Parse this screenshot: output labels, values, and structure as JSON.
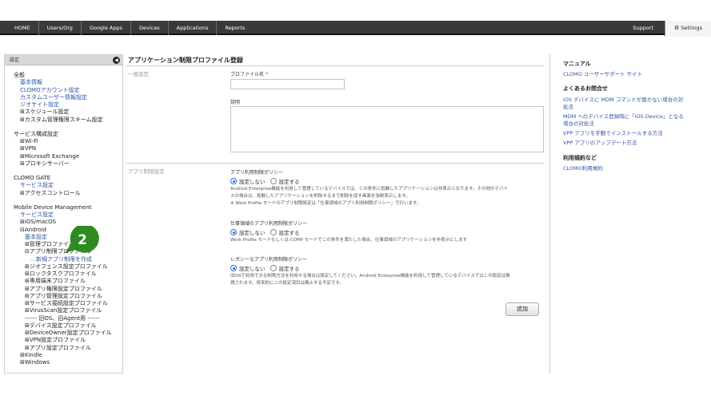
{
  "nav": {
    "items": [
      "HOME",
      "Users/Org",
      "Google Apps",
      "Devices",
      "Applications",
      "Reports"
    ],
    "support": "Support",
    "settings": "Settings"
  },
  "sidebar": {
    "title": "設定",
    "items": [
      {
        "text": "全般",
        "kind": "h",
        "indent": 0
      },
      {
        "text": "基本情報",
        "kind": "l",
        "indent": 1
      },
      {
        "text": "CLOMOアカウント設定",
        "kind": "l",
        "indent": 1
      },
      {
        "text": "カスタムユーザー情報設定",
        "kind": "l",
        "indent": 1
      },
      {
        "text": "ジオサイト設定",
        "kind": "l",
        "indent": 1
      },
      {
        "text": "⊞スケジュール設定",
        "kind": "d",
        "indent": 1
      },
      {
        "text": "⊞カスタム管理権限スキーム設定",
        "kind": "d",
        "indent": 1
      },
      {
        "text": "サービス構成設定",
        "kind": "h",
        "indent": 0
      },
      {
        "text": "⊞Wi-Fi",
        "kind": "d",
        "indent": 1
      },
      {
        "text": "⊞VPN",
        "kind": "d",
        "indent": 1
      },
      {
        "text": "⊞Microsoft Exchange",
        "kind": "d",
        "indent": 1
      },
      {
        "text": "⊞プロキシサーバー",
        "kind": "d",
        "indent": 1
      },
      {
        "text": "CLOMO GATE",
        "kind": "h",
        "indent": 0
      },
      {
        "text": "サービス設定",
        "kind": "l",
        "indent": 1
      },
      {
        "text": "⊞アクセスコントロール",
        "kind": "d",
        "indent": 1
      },
      {
        "text": "Mobile Device Management",
        "kind": "h",
        "indent": 0
      },
      {
        "text": "サービス設定",
        "kind": "l",
        "indent": 1
      },
      {
        "text": "⊞iOS/macOS",
        "kind": "d",
        "indent": 1
      },
      {
        "text": "⊟Android",
        "kind": "d",
        "indent": 1
      },
      {
        "text": "基本設定",
        "kind": "l",
        "indent": 2
      },
      {
        "text": "⊞管理プロファイル",
        "kind": "d",
        "indent": 2
      },
      {
        "text": "⊟アプリ制限プロファイル",
        "kind": "d",
        "indent": 2
      },
      {
        "text": "…新規アプリ制限を作成",
        "kind": "l",
        "indent": 3
      },
      {
        "text": "⊞ジオフェンス設定プロファイル",
        "kind": "d",
        "indent": 2
      },
      {
        "text": "⊞ロックタスクプロファイル",
        "kind": "d",
        "indent": 2
      },
      {
        "text": "⊞専用端末プロファイル",
        "kind": "d",
        "indent": 2
      },
      {
        "text": "⊞アプリ権限設定プロファイル",
        "kind": "d",
        "indent": 2
      },
      {
        "text": "⊞アプリ管理設定プロファイル",
        "kind": "d",
        "indent": 2
      },
      {
        "text": "⊞サービス接続設定プロファイル",
        "kind": "d",
        "indent": 2
      },
      {
        "text": "⊞VirusScan設定プロファイル",
        "kind": "d",
        "indent": 2
      },
      {
        "text": "------ 旧OS、旧Agent用 ------",
        "kind": "d",
        "indent": 2
      },
      {
        "text": "⊞デバイス設定プロファイル",
        "kind": "d",
        "indent": 2
      },
      {
        "text": "⊞DeviceOwner設定プロファイル",
        "kind": "d",
        "indent": 2
      },
      {
        "text": "⊞VPN設定プロファイル",
        "kind": "d",
        "indent": 2
      },
      {
        "text": "⊞アプリ設定プロファイル",
        "kind": "d",
        "indent": 2
      },
      {
        "text": "⊞Kindle",
        "kind": "d",
        "indent": 1
      },
      {
        "text": "⊞Windows",
        "kind": "d",
        "indent": 1
      }
    ],
    "badge_number": "2"
  },
  "main": {
    "title": "アプリケーション制限プロファイル登録",
    "general_section": "一般設定",
    "profile_name_label": "プロファイル名",
    "required_mark": "*",
    "description_label": "説明",
    "app_section": "アプリ制限設定",
    "policy1": {
      "label": "アプリ利用制限ポリシー",
      "opt_off": "設定しない",
      "opt_on": "設定する",
      "desc": [
        "Android Enterprise機能を利用して管理しているデバイスでは、この条件に抵触したアプリケーションは非表示となります。その他のデバイ",
        "スの場合は、抵触したアプリケーションを削除するまで削除を促す画面を強制表示します。",
        "※ Work Profile モードのアプリ制限設定は「仕事領域のアプリ利用制限ポリシー」で行います。"
      ]
    },
    "policy2": {
      "label": "仕事領域のアプリ利用制限ポリシー",
      "opt_off": "設定しない",
      "opt_on": "設定する",
      "desc": [
        "Work Profile モードもしくは COMP モードでこの条件を満たした場合、仕事領域のアプリケーションを非表示にします"
      ]
    },
    "policy3": {
      "label": "レガシーなアプリ利用制限ポリシー",
      "opt_off": "設定しない",
      "opt_on": "設定する",
      "desc": [
        "旧OSで利用できる制限方法を利用する場合は設定してください。Android Enterprise機能を利用して管理しているデバイスではこの設定は無",
        "視されます。将来的にこの設定項目は廃止する予定です。"
      ]
    },
    "add_button": "追加"
  },
  "right": {
    "manual_heading": "マニュアル",
    "manual_link": "CLOMO ユーザーサポート サイト",
    "faq_heading": "よくあるお問合せ",
    "faq_links": [
      "iOS デバイスに MDM コマンドが届かない場合の対",
      "処法",
      "MDM へのデバイス登録時に「iOS Device」となる",
      "場合の対処法",
      "VPP アプリを手動でインストールする方法",
      "VPP アプリのアップデート方法"
    ],
    "terms_heading": "利用規約など",
    "terms_link": "CLOMO利用規約"
  },
  "colors": {
    "link": "#2b57a6",
    "topbar": "#3a3a3a",
    "badge": "#2e8b22"
  }
}
